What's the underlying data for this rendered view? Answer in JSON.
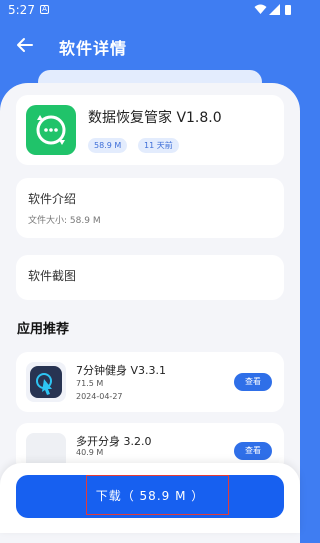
{
  "status_bar": {
    "time": "5:27",
    "notification_icon": "notification-icon",
    "wifi_icon": "wifi-icon",
    "signal_icon": "signal-icon",
    "battery_icon": "battery-icon"
  },
  "appbar": {
    "title": "软件详情",
    "back_icon": "back-arrow-icon"
  },
  "app": {
    "name": "数据恢复管家 V1.8.0",
    "size": "58.9 M",
    "updated": "11 天前",
    "icon": "chat-bubble-icon",
    "icon_color": "#20c36a"
  },
  "intro": {
    "title": "软件介绍",
    "file_size_label": "文件大小:",
    "file_size_value": "58.9 M"
  },
  "screenshots": {
    "title": "软件截图"
  },
  "recommend": {
    "title": "应用推荐",
    "items": [
      {
        "name": "7分钟健身 V3.3.1",
        "size": "71.5 M",
        "date": "2024-04-27",
        "action": "查看",
        "icon": "touch-icon"
      },
      {
        "name": "多开分身 3.2.0",
        "size": "40.9 M",
        "action": "查看",
        "icon": "app-placeholder-icon"
      }
    ]
  },
  "download": {
    "label": "下载（ 58.9 M ）"
  },
  "colors": {
    "primary": "#3f7df2",
    "download_button": "#1760f0",
    "highlight_border": "#e23b3b",
    "background": "#f4f5f9"
  }
}
